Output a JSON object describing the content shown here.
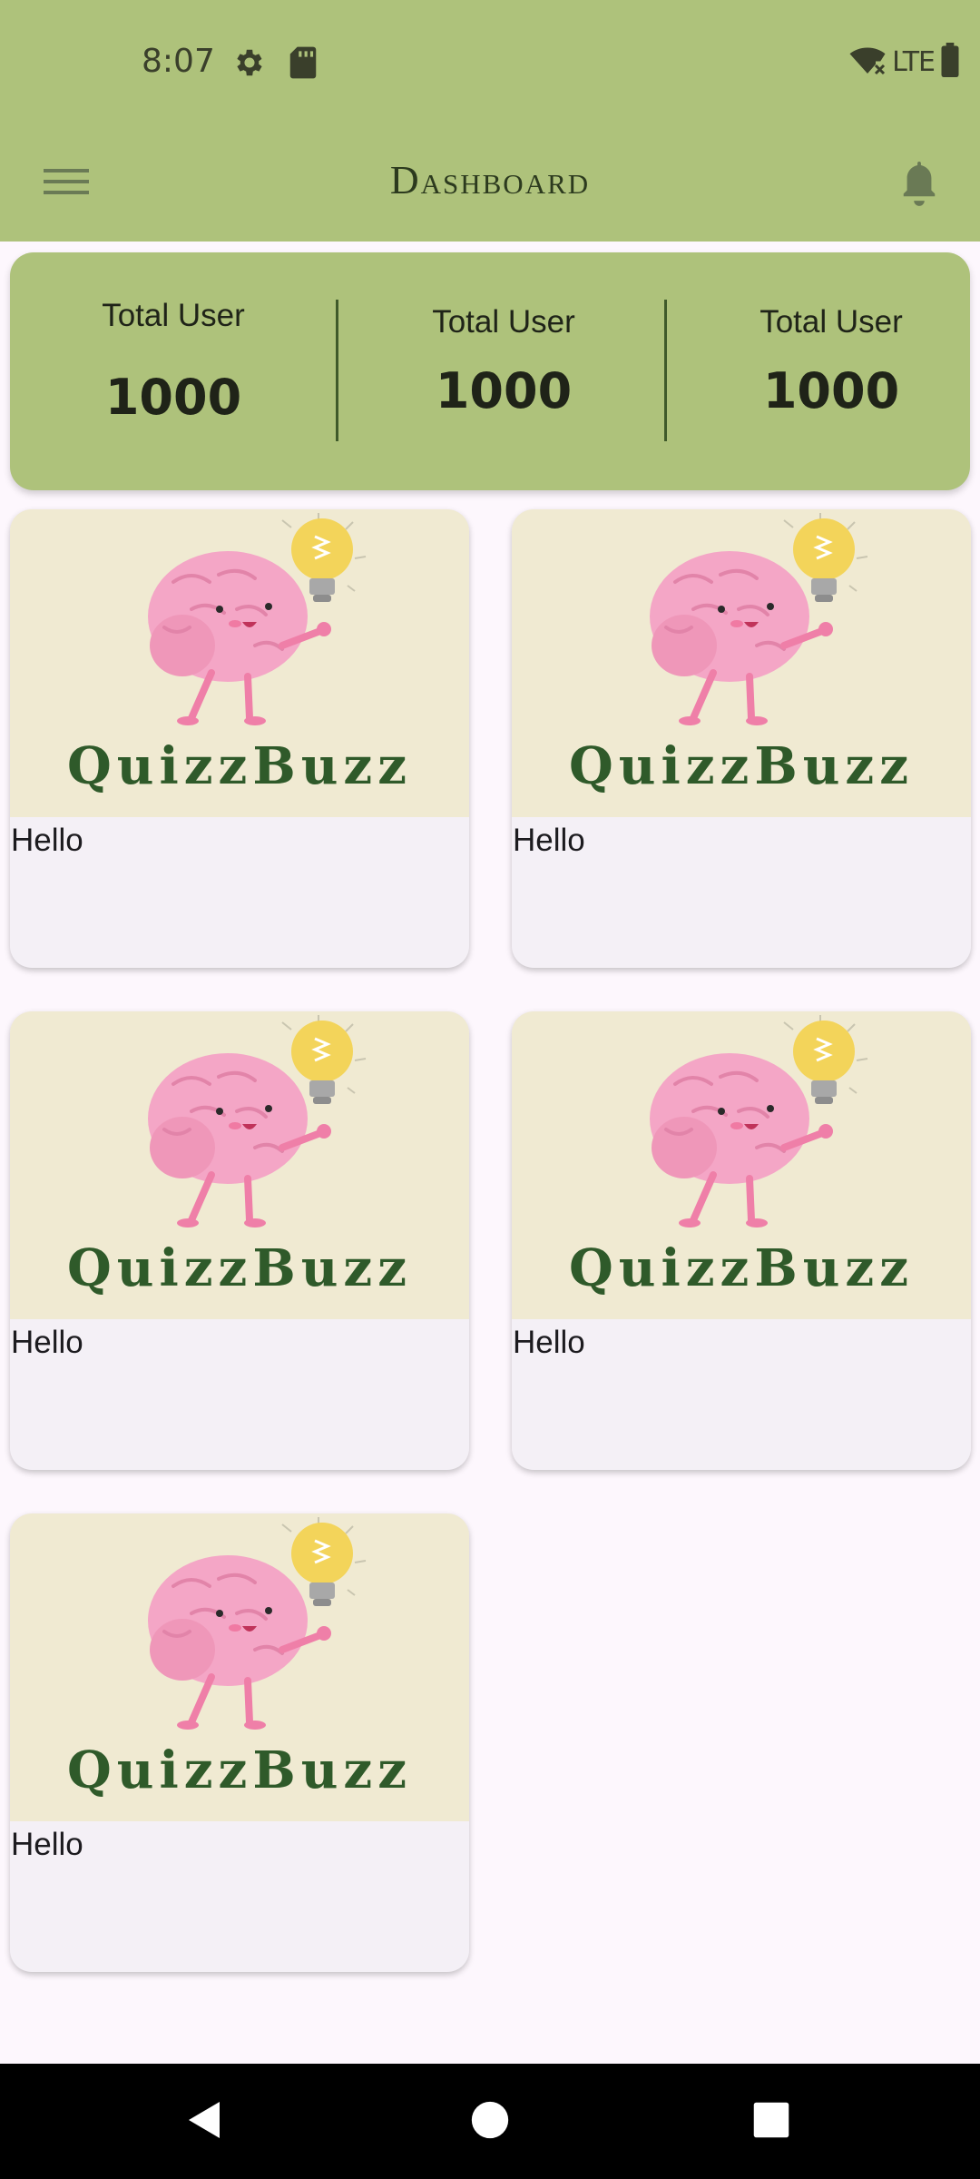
{
  "status_bar": {
    "time": "8:07",
    "network": "LTE",
    "icons": [
      "settings-icon",
      "sd-card-icon",
      "wifi-off-icon",
      "battery-icon"
    ]
  },
  "app_bar": {
    "title": "Dashboard",
    "menu_icon": "hamburger-menu-icon",
    "notification_icon": "bell-icon"
  },
  "stats": [
    {
      "label": "Total User",
      "value": "1000"
    },
    {
      "label": "Total User",
      "value": "1000"
    },
    {
      "label": "Total User",
      "value": "1000"
    }
  ],
  "cards": [
    {
      "label": "Hello",
      "logo_text": "QuizzBuzz"
    },
    {
      "label": "Hello",
      "logo_text": "QuizzBuzz"
    },
    {
      "label": "Hello",
      "logo_text": "QuizzBuzz"
    },
    {
      "label": "Hello",
      "logo_text": "QuizzBuzz"
    },
    {
      "label": "Hello",
      "logo_text": "QuizzBuzz"
    }
  ],
  "nav_bar": {
    "icons": [
      "back-icon",
      "home-icon",
      "recents-icon"
    ]
  },
  "colors": {
    "accent": "#aec27b",
    "background": "#fdf7fd",
    "card": "#f4f0f6",
    "logo_bg": "#f0ead2",
    "logo_text": "#2f5a2a"
  }
}
